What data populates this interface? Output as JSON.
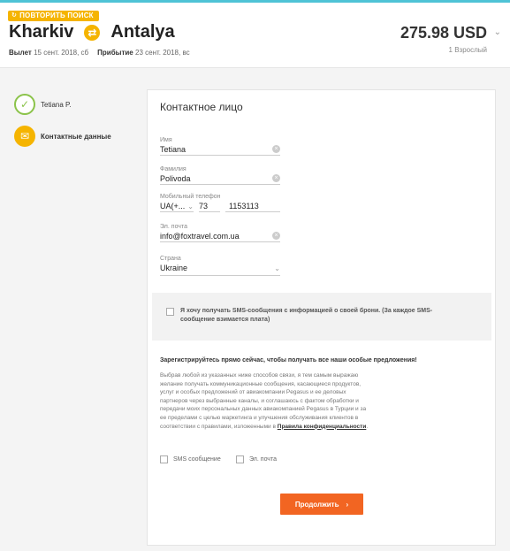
{
  "header": {
    "repeat_search": "ПОВТОРИТЬ ПОИСК",
    "origin": "Kharkiv",
    "destination": "Antalya",
    "departure_label": "Вылет",
    "departure_date": "15 сент. 2018, сб",
    "arrival_label": "Прибытие",
    "arrival_date": "23 сент. 2018, вс",
    "price": "275.98 USD",
    "passengers": "1 Взрослый"
  },
  "steps": [
    {
      "label": "Tetiana P.",
      "state": "done",
      "icon": "check-icon"
    },
    {
      "label": "Контактные данные",
      "state": "active",
      "icon": "envelope-icon"
    }
  ],
  "form": {
    "title": "Контактное лицо",
    "first_name_label": "Имя",
    "first_name_value": "Tetiana",
    "last_name_label": "Фамилия",
    "last_name_value": "Polivoda",
    "phone_label": "Мобильный телефон",
    "phone_country": "UA(+...",
    "phone_code": "73",
    "phone_number": "1153113",
    "email_label": "Эл. почта",
    "email_value": "info@foxtravel.com.ua",
    "country_label": "Страна",
    "country_value": "Ukraine"
  },
  "sms_opt": {
    "text": "Я хочу получать SMS-сообщения с информацией о своей брони. (За каждое SMS-сообщение взимается плата)"
  },
  "register": {
    "title": "Зарегистрируйтесь прямо сейчас, чтобы получать все наши особые предложения!",
    "text": "Выбрав любой из указанных ниже способов связи, я тем самым выражаю желание получать коммуникационные сообщения, касающиеся продуктов, услуг и особых предложений от авиакомпании Pegasus и ее деловых партнеров через выбранные каналы, и соглашаюсь с фактом обработки и передачи моих персональных данных авиакомпанией Pegasus в Турции и за ее пределами с целью маркетинга и улучшения обслуживания клиентов в соответствии с правилами, изложенными в",
    "link": "Правила конфиденциальности",
    "suffix": ".",
    "option_sms": "SMS сообщение",
    "option_email": "Эл. почта"
  },
  "continue_label": "Продолжить",
  "colors": {
    "accent": "#f5b400",
    "cta": "#f26522",
    "done": "#8bc34a"
  }
}
